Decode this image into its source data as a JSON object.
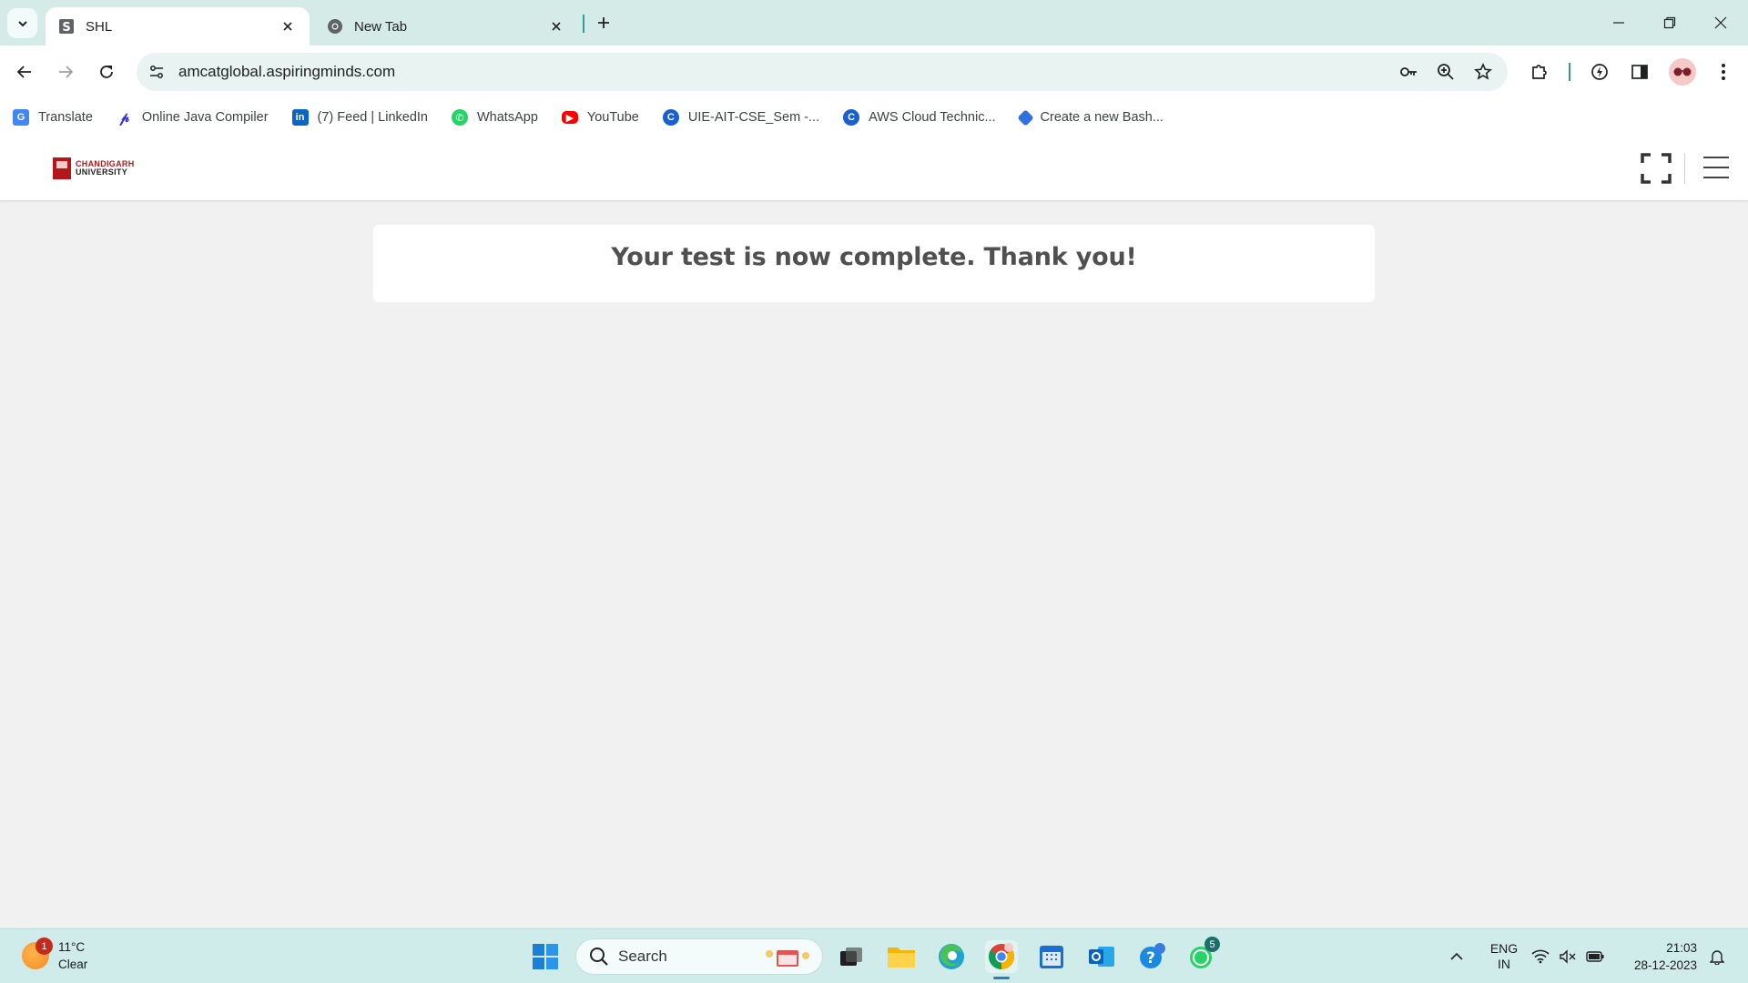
{
  "browser": {
    "tabs": [
      {
        "title": "SHL",
        "favicon": "shl-s-icon",
        "active": true
      },
      {
        "title": "New Tab",
        "favicon": "chrome-icon",
        "active": false
      }
    ],
    "url": "amcatglobal.aspiringminds.com",
    "bookmarks": [
      {
        "label": "Translate",
        "icon": "google-translate-icon",
        "color": "#4285f4"
      },
      {
        "label": "Online Java Compiler",
        "icon": "programiz-icon",
        "color": "#3b2fd8"
      },
      {
        "label": "(7) Feed | LinkedIn",
        "icon": "linkedin-icon",
        "color": "#0a66c2"
      },
      {
        "label": "WhatsApp",
        "icon": "whatsapp-icon",
        "color": "#25d366"
      },
      {
        "label": "YouTube",
        "icon": "youtube-icon",
        "color": "#ff0000"
      },
      {
        "label": "UIE-AIT-CSE_Sem -...",
        "icon": "classroom-c-icon",
        "color": "#1a5fd1"
      },
      {
        "label": "AWS Cloud Technic...",
        "icon": "classroom-c-icon",
        "color": "#1a5fd1"
      },
      {
        "label": "Create a new Bash...",
        "icon": "diamond-icon",
        "color": "#2f6fe0"
      }
    ]
  },
  "page": {
    "logo_line1": "CHANDIGARH",
    "logo_line2": "UNIVERSITY",
    "message": "Your test is now complete. Thank you!"
  },
  "taskbar": {
    "weather": {
      "temp": "11°C",
      "condition": "Clear",
      "badge": "1"
    },
    "search_label": "Search",
    "whatsapp_badge": "5",
    "language": {
      "line1": "ENG",
      "line2": "IN"
    },
    "time": "21:03",
    "date": "28-12-2023"
  },
  "colors": {
    "tabbar_bg": "#d5ebe8",
    "omnibox_bg": "#e9f3f1",
    "page_bg": "#f1f1f1",
    "brand_red": "#b3161b",
    "taskbar_bg": "#cfeceb"
  }
}
